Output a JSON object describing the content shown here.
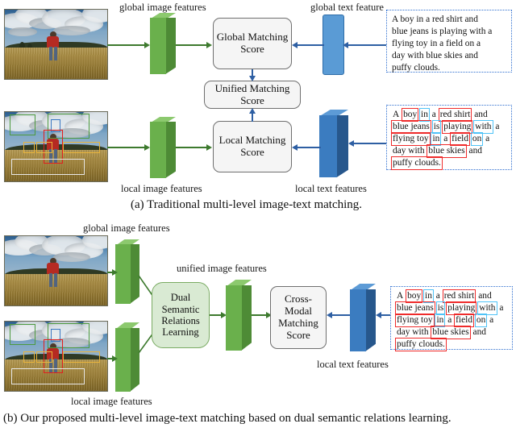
{
  "figure": {
    "caption_a": "(a) Traditional multi-level image-text matching.",
    "caption_b": "(b) Our proposed multi-level image-text matching based on dual semantic relations learning."
  },
  "panel_a": {
    "labels": {
      "global_image_features": "global image features",
      "global_text_feature": "global text feature",
      "local_image_features": "local image features",
      "local_text_features": "local text features"
    },
    "boxes": {
      "global_matching_score": "Global Matching Score",
      "unified_matching_score": "Unified Matching Score",
      "local_matching_score": "Local Matching Score"
    },
    "global_caption": {
      "lines": [
        "A boy in a red shirt and",
        "blue jeans is playing with a",
        "flying toy in a field on a",
        "day with blue skies and",
        "puffy clouds."
      ]
    },
    "local_caption": {
      "lines": [
        [
          {
            "t": "A",
            "h": "none"
          },
          {
            "t": "boy",
            "h": "red"
          },
          {
            "t": "in",
            "h": "cyan"
          },
          {
            "t": "a",
            "h": "none"
          },
          {
            "t": "red shirt",
            "h": "red"
          },
          {
            "t": "and",
            "h": "none"
          }
        ],
        [
          {
            "t": "blue jeans",
            "h": "red"
          },
          {
            "t": "is",
            "h": "cyan"
          },
          {
            "t": "playing",
            "h": "red"
          },
          {
            "t": "with",
            "h": "cyan"
          },
          {
            "t": "a",
            "h": "none"
          }
        ],
        [
          {
            "t": "flying toy",
            "h": "red"
          },
          {
            "t": "in",
            "h": "cyan"
          },
          {
            "t": "a",
            "h": "none"
          },
          {
            "t": "field",
            "h": "red"
          },
          {
            "t": "on",
            "h": "cyan"
          },
          {
            "t": "a",
            "h": "none"
          }
        ],
        [
          {
            "t": "day with",
            "h": "none"
          },
          {
            "t": "blue skies",
            "h": "red"
          },
          {
            "t": "and",
            "h": "none"
          }
        ],
        [
          {
            "t": "puffy clouds.",
            "h": "red"
          }
        ]
      ]
    }
  },
  "panel_b": {
    "labels": {
      "global_image_features": "global image features",
      "unified_image_features": "unified image features",
      "local_image_features": "local image features",
      "local_text_features": "local text features"
    },
    "boxes": {
      "dual_semantic_relations_learning": "Dual Semantic Relations Learning",
      "cross_modal_matching_score": "Cross- Modal Matching Score"
    },
    "local_caption": {
      "lines": [
        [
          {
            "t": "A",
            "h": "none"
          },
          {
            "t": "boy",
            "h": "red"
          },
          {
            "t": "in",
            "h": "cyan"
          },
          {
            "t": "a",
            "h": "none"
          },
          {
            "t": "red shirt",
            "h": "red"
          },
          {
            "t": "and",
            "h": "none"
          }
        ],
        [
          {
            "t": "blue jeans",
            "h": "red"
          },
          {
            "t": "is",
            "h": "cyan"
          },
          {
            "t": "playing",
            "h": "red"
          },
          {
            "t": "with",
            "h": "cyan"
          },
          {
            "t": "a",
            "h": "none"
          }
        ],
        [
          {
            "t": "flying toy",
            "h": "red"
          },
          {
            "t": "in",
            "h": "cyan"
          },
          {
            "t": "a",
            "h": "none"
          },
          {
            "t": "field",
            "h": "red"
          },
          {
            "t": "on",
            "h": "cyan"
          },
          {
            "t": "a",
            "h": "none"
          }
        ],
        [
          {
            "t": "day with",
            "h": "none"
          },
          {
            "t": "blue skies",
            "h": "red"
          },
          {
            "t": "and",
            "h": "none"
          }
        ],
        [
          {
            "t": "puffy clouds.",
            "h": "red"
          }
        ]
      ]
    }
  },
  "colors": {
    "green_arrow": "#3d7a2e",
    "blue_arrow": "#2e5fa3",
    "prism_green": "#6ab04c",
    "prism_blue": "#3b7cc0",
    "box_fill": "#f5f5f5",
    "greenbox_fill": "#d9ead3",
    "token_red": "#ef2b2b",
    "token_cyan": "#4fc3f7",
    "caption_border": "#2f6fd0"
  },
  "region_boxes": {
    "colors": [
      "#4d9a3f",
      "#3b78c2",
      "#e02020",
      "#e8b33c",
      "#e8e8e8"
    ]
  }
}
